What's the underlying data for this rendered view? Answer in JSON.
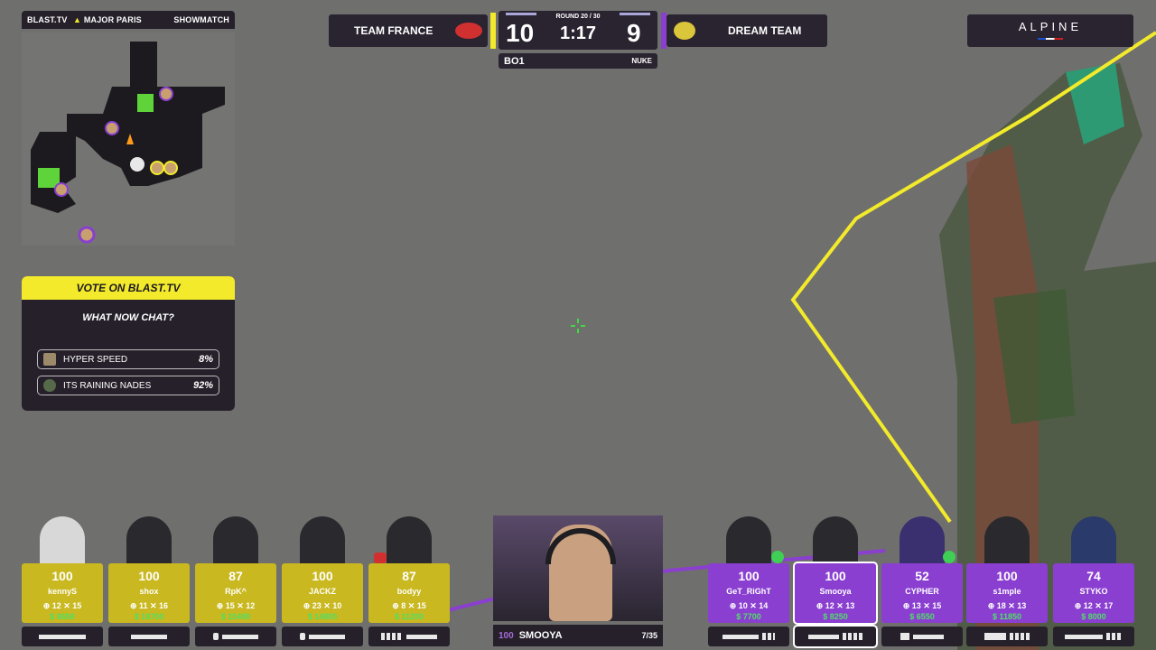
{
  "minimap": {
    "left_label": "BLAST.TV",
    "center_label": "MAJOR PARIS",
    "right_label": "SHOWMATCH"
  },
  "scoreboard": {
    "team_left": {
      "name": "TEAM FRANCE",
      "score": "10",
      "accent": "#f2ea2b"
    },
    "team_right": {
      "name": "DREAM TEAM",
      "score": "9",
      "accent": "#8a3fd0"
    },
    "round": "ROUND 20 / 30",
    "clock": "1:17",
    "format": "BO1",
    "map": "NUKE"
  },
  "sponsor": {
    "name": "ALPINE"
  },
  "vote": {
    "header": "VOTE ON BLAST.TV",
    "question": "WHAT NOW CHAT?",
    "options": [
      {
        "label": "HYPER SPEED",
        "percent": "8%"
      },
      {
        "label": "ITS RAINING NADES",
        "percent": "92%"
      }
    ]
  },
  "team_left_players": [
    {
      "name": "kennyS",
      "hp": "100",
      "kills": "12",
      "deaths": "15",
      "money": "$ 8650"
    },
    {
      "name": "shox",
      "hp": "100",
      "kills": "11",
      "deaths": "16",
      "money": "$ 10700"
    },
    {
      "name": "RpK^",
      "hp": "87",
      "kills": "15",
      "deaths": "12",
      "money": "$ 15400"
    },
    {
      "name": "JACKZ",
      "hp": "100",
      "kills": "23",
      "deaths": "10",
      "money": "$ 14800"
    },
    {
      "name": "bodyy",
      "hp": "87",
      "kills": "8",
      "deaths": "15",
      "money": "$ 11200"
    }
  ],
  "team_right_players": [
    {
      "name": "GeT_RiGhT",
      "hp": "100",
      "kills": "10",
      "deaths": "14",
      "money": "$ 7700"
    },
    {
      "name": "Smooya",
      "hp": "100",
      "kills": "12",
      "deaths": "13",
      "money": "$ 8250"
    },
    {
      "name": "CYPHER",
      "hp": "52",
      "kills": "13",
      "deaths": "15",
      "money": "$ 6550"
    },
    {
      "name": "s1mple",
      "hp": "100",
      "kills": "18",
      "deaths": "13",
      "money": "$ 11850"
    },
    {
      "name": "STYKO",
      "hp": "74",
      "kills": "12",
      "deaths": "17",
      "money": "$ 8000"
    }
  ],
  "spectated": {
    "hp": "100",
    "name": "SMOOYA",
    "ammo": "7/35"
  },
  "colors": {
    "t_side": "#c9b820",
    "ct_side": "#8a3fd0",
    "panel": "#26202a",
    "money": "#4ee065"
  }
}
